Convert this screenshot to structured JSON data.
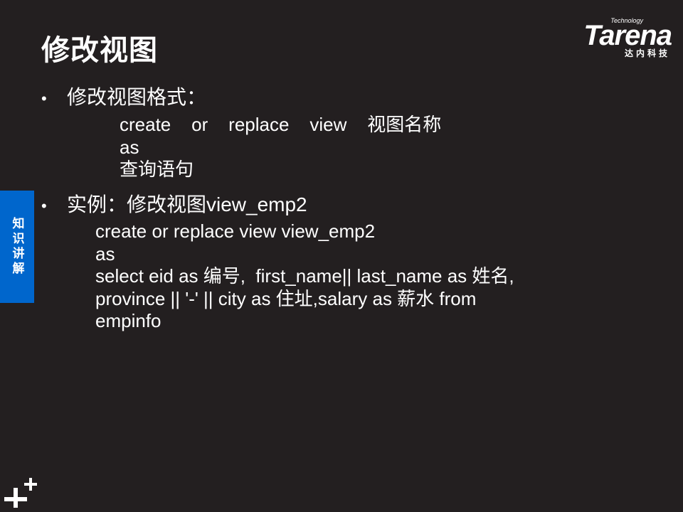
{
  "title": "修改视图",
  "logo": {
    "small": "Technology",
    "word": "Tarena",
    "cn": "达内科技"
  },
  "side_tab": "知识讲解",
  "bullet1": {
    "text": "修改视图格式：",
    "lines": [
      "create    or    replace    view    视图名称",
      "as",
      "查询语句"
    ]
  },
  "bullet2": {
    "text": "实例：修改视图view_emp2",
    "lines": [
      "create or replace view view_emp2",
      "as",
      "select eid as 编号,  first_name|| last_name as 姓名,",
      "province || '-' || city as 住址,salary as 薪水 from",
      "empinfo"
    ]
  }
}
